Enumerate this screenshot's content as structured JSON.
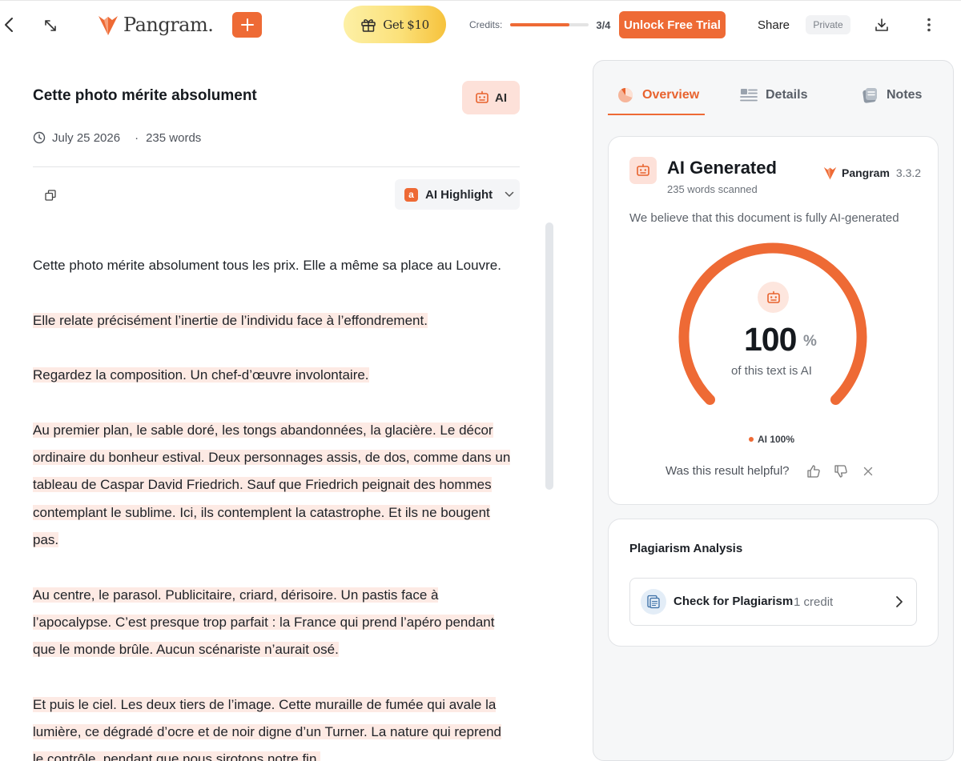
{
  "header": {
    "logo_text": "Pangram.",
    "gift_label": "Get $10",
    "credits_label": "Credits:",
    "credits_used": 3,
    "credits_total": 4,
    "credits_count": "3/4",
    "unlock_label": "Unlock Free Trial",
    "share_label": "Share",
    "private_label": "Private",
    "accent_color": "#ee6a35"
  },
  "document": {
    "title": "Cette photo mérite absolument",
    "ai_chip_label": "AI",
    "date": "July 25 2026",
    "meta_separator": "·",
    "word_count": "235 words",
    "highlight_label": "AI Highlight",
    "highlight_badge": "a",
    "paragraphs": [
      [
        "Cette photo mérite absolument tous les prix. Elle a même sa place au Louvre."
      ],
      [
        "Elle relate précisément l’inertie de l’individu face à l’effondrement."
      ],
      [
        "Regardez la composition. Un chef-d’œuvre involontaire."
      ],
      [
        "Au premier plan, le sable doré, les tongs abandonnées, la glacière. Le décor",
        "ordinaire du bonheur estival. Deux personnages assis, de dos, comme dans un",
        "tableau de Caspar David Friedrich. Sauf que Friedrich peignait des hommes",
        "contemplant le sublime. Ici, ils contemplent la catastrophe. Et ils ne bougent",
        "pas."
      ],
      [
        "Au centre, le parasol. Publicitaire, criard, dérisoire. Un pastis face à",
        "l’apocalypse. C’est presque trop parfait : la France qui prend l’apéro pendant",
        "que le monde brûle. Aucun scénariste n’aurait osé."
      ],
      [
        "Et puis le ciel. Les deux tiers de l’image. Cette muraille de fumée qui avale la",
        "lumière, ce dégradé d’ocre et de noir digne d’un Turner. La nature qui reprend",
        "le contrôle, pendant que nous sirotons notre fin."
      ]
    ]
  },
  "panel": {
    "tabs": [
      {
        "label": "Overview",
        "active": true
      },
      {
        "label": "Details",
        "active": false
      },
      {
        "label": "Notes",
        "active": false
      }
    ],
    "result": {
      "title": "AI Generated",
      "subtitle": "235 words scanned",
      "brand_name": "Pangram",
      "brand_version": "3.3.2",
      "belief": "We believe that this document is fully AI-generated",
      "score": 100,
      "score_text": "100",
      "score_unit": "%",
      "caption": "of this text is AI",
      "legend": "AI 100%",
      "feedback_question": "Was this result helpful?"
    },
    "plagiarism": {
      "title": "Plagiarism Analysis",
      "button_label": "Check for Plagiarism",
      "cost": "1 credit"
    }
  }
}
